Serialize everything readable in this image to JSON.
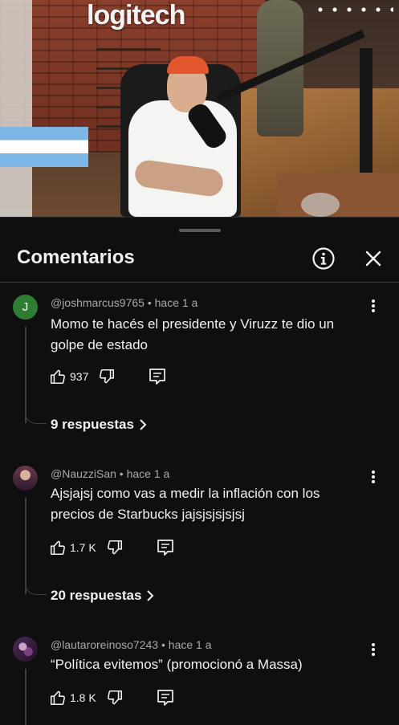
{
  "video": {
    "logo_text": "logitech"
  },
  "panel": {
    "title": "Comentarios",
    "info_icon": "info-icon",
    "close_icon": "close-icon"
  },
  "comments": [
    {
      "author": "@joshmarcus9765",
      "time": "hace 1 a",
      "text": "Momo te hacés el presidente y Viruzz te dio un golpe de estado",
      "likes": "937",
      "replies_label": "9 respuestas",
      "avatar_letter": "J",
      "avatar_color": "#2e7d32"
    },
    {
      "author": "@NauzziSan",
      "time": "hace 1 a",
      "text": "Ajsjajsj como vas a medir la inflación con los precios de Starbucks jajsjsjsjsjsj",
      "likes": "1.7 K",
      "replies_label": "20 respuestas"
    },
    {
      "author": "@lautaroreinoso7243",
      "time": "hace 1 a",
      "text": "“Política evitemos” (promocionó a Massa)",
      "likes": "1.8 K"
    }
  ],
  "separator": " • "
}
